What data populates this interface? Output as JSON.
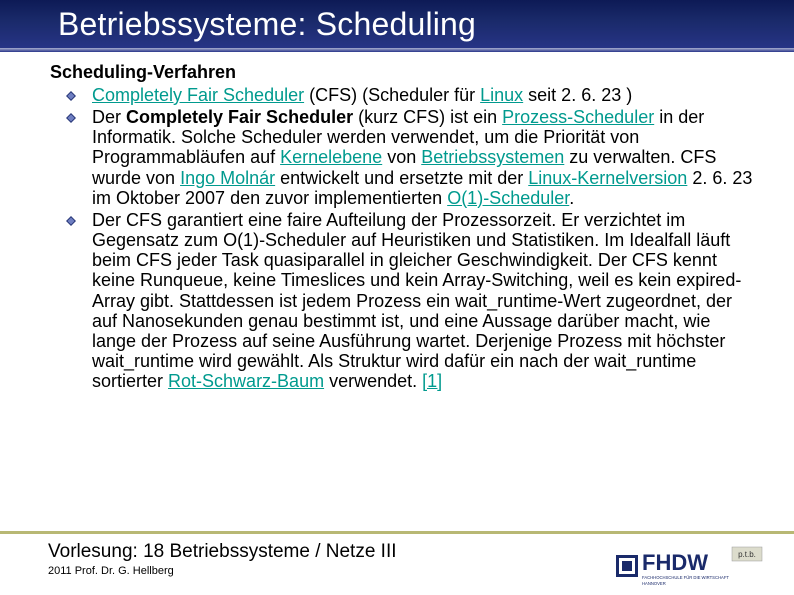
{
  "title": "Betriebssysteme: Scheduling",
  "section_heading": "Scheduling-Verfahren",
  "bullets": [
    {
      "pre": "",
      "link1": "Completely Fair Scheduler",
      "mid1": " (CFS) (Scheduler für ",
      "link2": "Linux",
      "mid2": " seit 2. 6. 23 )"
    }
  ],
  "bullet2": {
    "lead": "Der ",
    "bold": "Completely Fair Scheduler",
    "after_bold": " (kurz CFS) ist ein ",
    "link_a": "Prozess-Scheduler",
    "seg1": " in der Informatik. Solche Scheduler werden verwendet, um die Priorität von Programmabläufen auf ",
    "link_b": "Kernelebene",
    "seg2": " von ",
    "link_c": "Betriebssystemen",
    "seg3": " zu verwalten. CFS wurde von ",
    "link_d": "Ingo Molnár",
    "seg4": " entwickelt und ersetzte mit der ",
    "link_e": "Linux-Kernelversion",
    "seg5": " 2. 6. 23 im Oktober 2007 den zuvor implementierten ",
    "link_f": "O(1)-Scheduler",
    "seg6": "."
  },
  "bullet3": {
    "seg1": "Der CFS garantiert eine faire Aufteilung der Prozessorzeit. Er verzichtet im Gegensatz zum O(1)-Scheduler auf Heuristiken und Statistiken. Im Idealfall läuft beim CFS jeder Task quasiparallel in gleicher Geschwindigkeit. Der CFS kennt keine Runqueue, keine Timeslices und kein Array-Switching, weil es kein expired-Array gibt. Stattdessen ist jedem Prozess ein wait_runtime-Wert zugeordnet, der auf Nanosekunden genau bestimmt ist, und eine Aussage darüber macht, wie lange der Prozess auf seine Ausführung wartet. Derjenige Prozess mit höchster wait_runtime wird gewählt. Als Struktur wird dafür ein nach der wait_runtime sortierter ",
    "link_a": "Rot-Schwarz-Baum",
    "seg2": " verwendet. ",
    "link_b": "[1]"
  },
  "footer": {
    "label": "Vorlesung:",
    "value": " 18 Betriebssysteme / Netze III",
    "copyright": "2011 Prof. Dr. G. Hellberg"
  },
  "logo": {
    "main": "FHDW",
    "sub1": "FACHHOCHSCHULE FÜR DIE WIRTSCHAFT",
    "sub2": "HANNOVER",
    "tag": "p.t.b."
  }
}
